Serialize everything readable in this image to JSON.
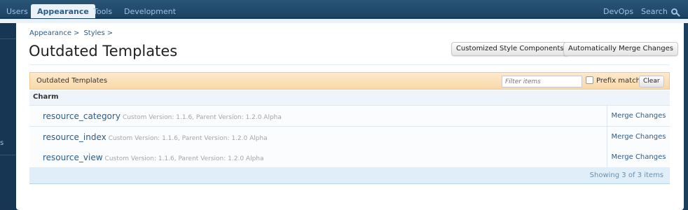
{
  "nav": {
    "tabs": [
      {
        "label": "Users"
      },
      {
        "label": "Appearance"
      },
      {
        "label": "Tools"
      },
      {
        "label": "Development"
      }
    ],
    "right": {
      "devops": "DevOps",
      "search": "Search"
    }
  },
  "breadcrumb": [
    "Appearance",
    "Styles"
  ],
  "page_title": "Outdated Templates",
  "actions": {
    "customized": "Customized Style Components",
    "merge_all": "Automatically Merge Changes"
  },
  "list": {
    "header": "Outdated Templates",
    "filter_placeholder": "Filter items",
    "prefix_match": "Prefix match",
    "clear": "Clear",
    "group": "Charm",
    "rows": [
      {
        "name": "resource_category",
        "meta": "Custom Version: 1.1.6, Parent Version: 1.2.0 Alpha",
        "action": "Merge Changes"
      },
      {
        "name": "resource_index",
        "meta": "Custom Version: 1.1.6, Parent Version: 1.2.0 Alpha",
        "action": "Merge Changes"
      },
      {
        "name": "resource_view",
        "meta": "Custom Version: 1.1.6, Parent Version: 1.2.0 Alpha",
        "action": "Merge Changes"
      }
    ],
    "footer": "Showing 3 of 3 items"
  },
  "sidebar": {
    "glyph": "s"
  },
  "colors": {
    "nav": "#1c4364",
    "accent": "#2d5c86",
    "header_bg": "#fde9cc",
    "footer_bg": "#dfeef9"
  }
}
